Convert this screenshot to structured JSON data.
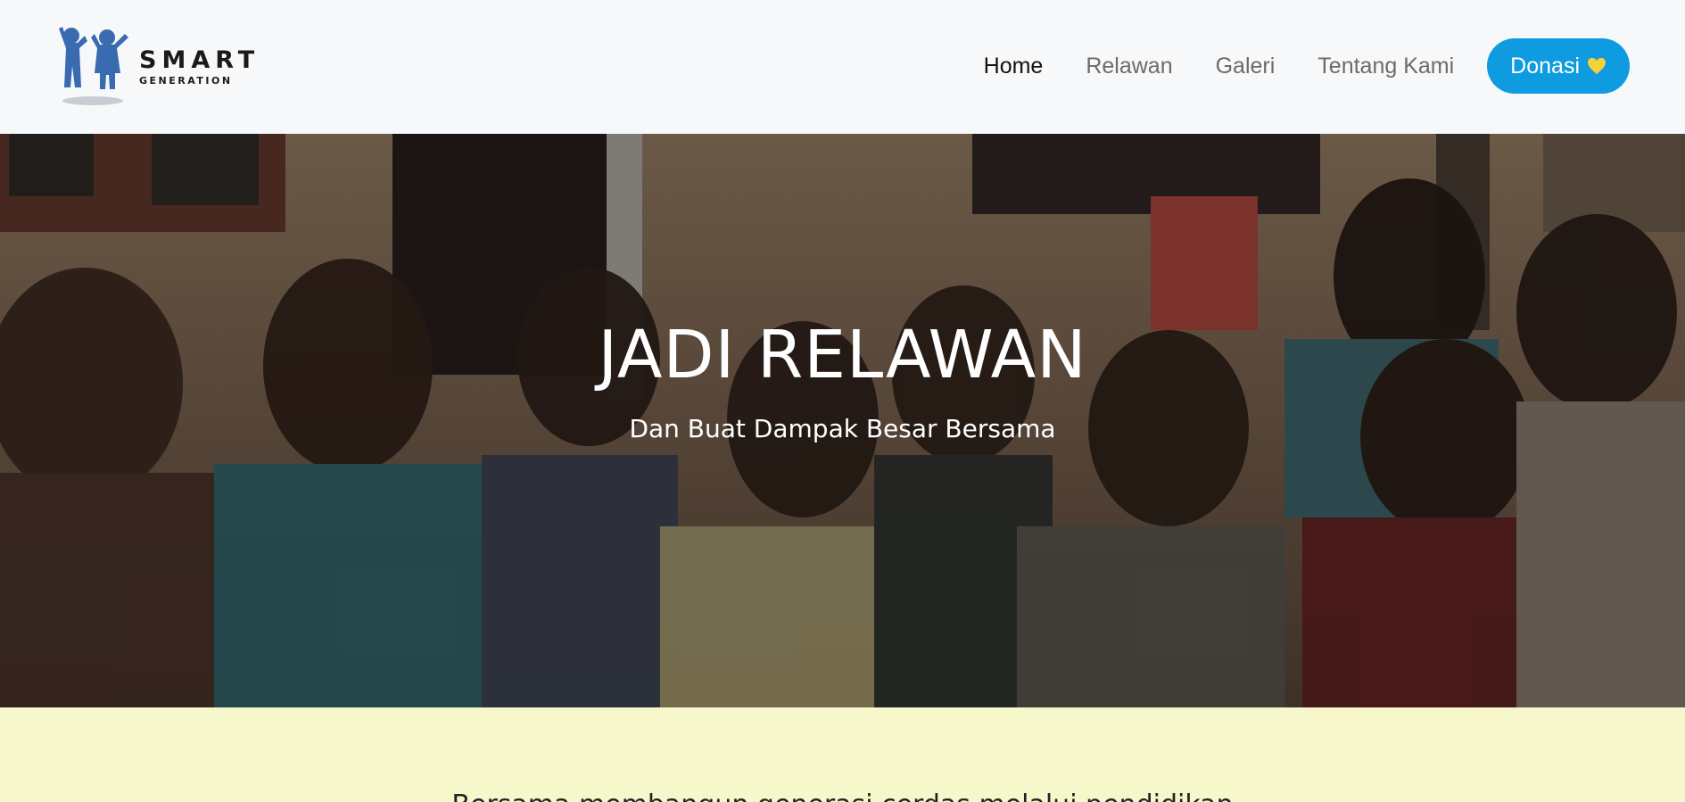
{
  "brand": {
    "name": "SMART",
    "tagline": "GENERATION",
    "logo_icon": "two-children-icon",
    "logo_color": "#3a6bb0"
  },
  "nav": {
    "items": [
      {
        "label": "Home",
        "active": true
      },
      {
        "label": "Relawan",
        "active": false
      },
      {
        "label": "Galeri",
        "active": false
      },
      {
        "label": "Tentang Kami",
        "active": false
      }
    ],
    "donate_label": "Donasi",
    "donate_icon": "heart-icon",
    "donate_color": "#0e9be0",
    "heart_color": "#f5d23b"
  },
  "hero": {
    "title": "JADI RELAWAN",
    "subtitle": "Dan Buat Dampak Besar Bersama"
  },
  "band": {
    "background": "#f6f8cb",
    "text": "Bersama membangun generasi cerdas melalui pendidikan"
  }
}
